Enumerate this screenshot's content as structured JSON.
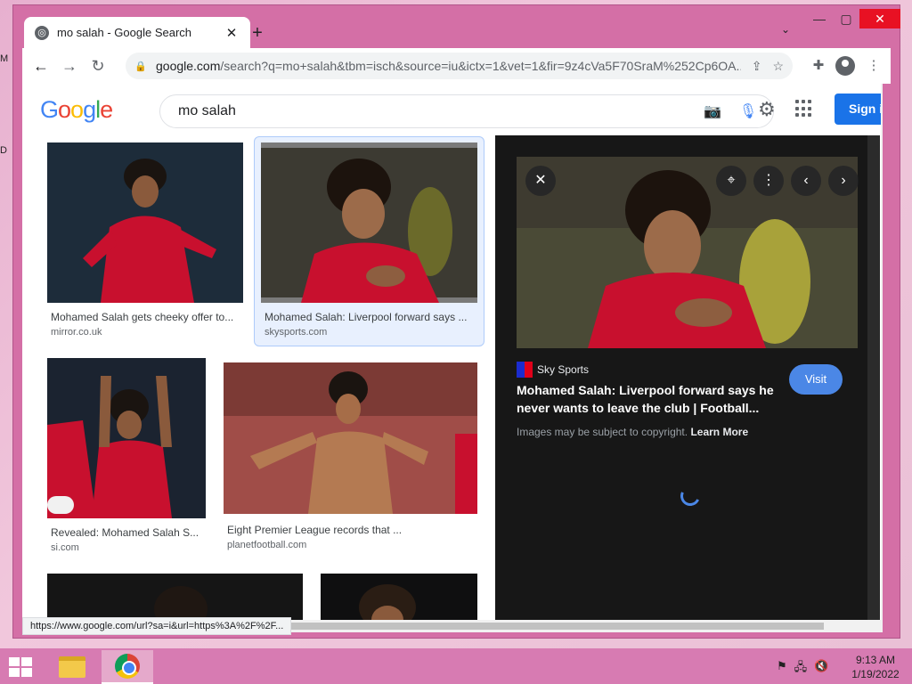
{
  "browser": {
    "tab_title": "mo salah - Google Search",
    "url_host": "google.com",
    "url_path": "/search?q=mo+salah&tbm=isch&source=iu&ictx=1&vet=1&fir=9z4cVa5F70SraM%252Cp6OA...",
    "status_url": "https://www.google.com/url?sa=i&url=https%3A%2F%2F..."
  },
  "search": {
    "logo": "Google",
    "query": "mo salah",
    "signin": "Sign in"
  },
  "results": [
    {
      "title": "Mohamed Salah gets cheeky offer to...",
      "source": "mirror.co.uk"
    },
    {
      "title": "Mohamed Salah: Liverpool forward says ...",
      "source": "skysports.com"
    },
    {
      "title": "Revealed: Mohamed Salah S...",
      "source": "si.com"
    },
    {
      "title": "Eight Premier League records that ...",
      "source": "planetfootball.com"
    }
  ],
  "preview": {
    "source_name": "Sky Sports",
    "title": "Mohamed Salah: Liverpool forward says he never wants to leave the club | Football...",
    "visit": "Visit",
    "copyright": "Images may be subject to copyright.",
    "learn_more": "Learn More"
  },
  "taskbar": {
    "time": "9:13 AM",
    "date": "1/19/2022"
  },
  "colors": {
    "window_frame": "#d46fa6",
    "taskbar": "#d77bb2",
    "accent_blue": "#1a73e8",
    "preview_bg": "#171717"
  }
}
